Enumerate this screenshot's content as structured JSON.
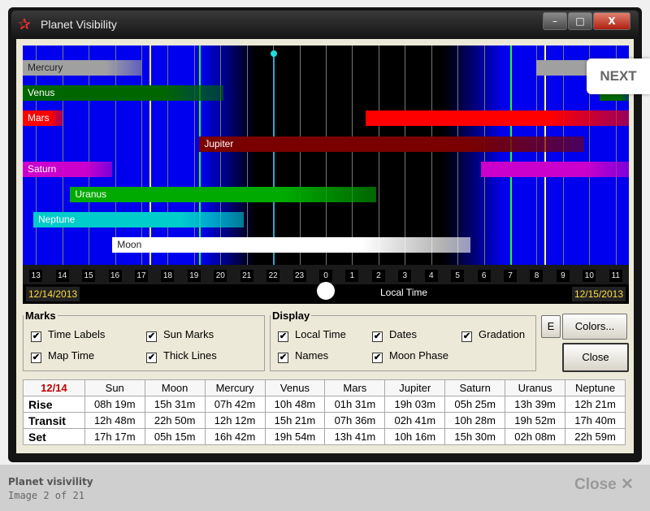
{
  "window": {
    "title": "Planet Visibility",
    "controls": {
      "minimize": "–",
      "maximize": "□",
      "close": "X"
    }
  },
  "chart_data": {
    "type": "timeline",
    "x_ticks": [
      "13",
      "14",
      "15",
      "16",
      "17",
      "18",
      "19",
      "20",
      "21",
      "22",
      "23",
      "0",
      "1",
      "2",
      "3",
      "4",
      "5",
      "6",
      "7",
      "8",
      "9",
      "10",
      "11"
    ],
    "x_range_hours": [
      12.5,
      35.5
    ],
    "xlabel": "Local Time",
    "start_date": "12/14/2013",
    "end_date": "12/15/2013",
    "sun_marks": {
      "sunset": 17.3,
      "sunrise": 32.3
    },
    "thick_lines": {
      "dusk": 19.2,
      "dawn": 31.0
    },
    "now": 22.0,
    "series": [
      {
        "name": "Mercury",
        "color": "#a0a0a0",
        "segments": [
          [
            12.5,
            17.0
          ],
          [
            32.0,
            35.5
          ]
        ]
      },
      {
        "name": "Venus",
        "color": "#006600",
        "segments": [
          [
            12.5,
            20.1
          ],
          [
            34.4,
            35.5
          ]
        ]
      },
      {
        "name": "Mars",
        "color": "#ff0000",
        "segments": [
          [
            12.5,
            14.0
          ],
          [
            25.5,
            35.5
          ]
        ]
      },
      {
        "name": "Jupiter",
        "color": "#7a0000",
        "segments": [
          [
            19.2,
            33.8
          ]
        ]
      },
      {
        "name": "Saturn",
        "color": "#cc00cc",
        "segments": [
          [
            12.5,
            15.9
          ],
          [
            29.9,
            35.5
          ]
        ]
      },
      {
        "name": "Uranus",
        "color": "#00aa00",
        "segments": [
          [
            14.3,
            25.9
          ]
        ]
      },
      {
        "name": "Neptune",
        "color": "#00cccc",
        "segments": [
          [
            12.9,
            20.9
          ]
        ]
      },
      {
        "name": "Moon",
        "color": "#ffffff",
        "segments": [
          [
            15.9,
            29.5
          ]
        ]
      }
    ]
  },
  "next_label": "NEXT",
  "marks": {
    "legend": "Marks",
    "time_labels": "Time Labels",
    "sun_marks": "Sun Marks",
    "map_time": "Map Time",
    "thick_lines": "Thick Lines"
  },
  "display": {
    "legend": "Display",
    "local_time": "Local Time",
    "dates": "Dates",
    "gradation": "Gradation",
    "names": "Names",
    "moon_phase": "Moon Phase"
  },
  "checkbox_mark": "✔",
  "buttons": {
    "e": "E",
    "colors": "Colors...",
    "close": "Close"
  },
  "table": {
    "date": "12/14",
    "headers": [
      "Sun",
      "Moon",
      "Mercury",
      "Venus",
      "Mars",
      "Jupiter",
      "Saturn",
      "Uranus",
      "Neptune"
    ],
    "rows": [
      {
        "label": "Rise",
        "values": [
          "08h 19m",
          "15h 31m",
          "07h 42m",
          "10h 48m",
          "01h 31m",
          "19h 03m",
          "05h 25m",
          "13h 39m",
          "12h 21m"
        ]
      },
      {
        "label": "Transit",
        "values": [
          "12h 48m",
          "22h 50m",
          "12h 12m",
          "15h 21m",
          "07h 36m",
          "02h 41m",
          "10h 28m",
          "19h 52m",
          "17h 40m"
        ]
      },
      {
        "label": "Set",
        "values": [
          "17h 17m",
          "05h 15m",
          "16h 42m",
          "19h 54m",
          "13h 41m",
          "10h 16m",
          "15h 30m",
          "02h 08m",
          "22h 59m"
        ]
      }
    ]
  },
  "caption": {
    "title": "Planet visivility",
    "subtitle": "Image 2 of 21",
    "close": "Close"
  }
}
